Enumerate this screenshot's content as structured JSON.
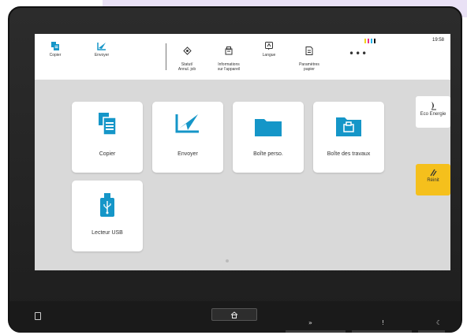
{
  "topbar": {
    "items": [
      {
        "label": "Copier",
        "icon": "copy-icon"
      },
      {
        "label": "Envoyer",
        "icon": "send-icon"
      },
      {
        "label": "Statut/\nAnnul. job",
        "icon": "status-icon"
      },
      {
        "label": "Informations\nsur l'appareil",
        "icon": "device-info-icon"
      },
      {
        "label": "Langue",
        "icon": "language-icon"
      },
      {
        "label": "Paramètres\npapier",
        "icon": "paper-settings-icon"
      }
    ],
    "more": "•••",
    "clock": "19:58",
    "toner_colors": [
      "#f2d21b",
      "#e8318a",
      "#27b3e6",
      "#111111"
    ]
  },
  "tiles": [
    {
      "label": "Copier",
      "icon": "copy-icon"
    },
    {
      "label": "Envoyer",
      "icon": "send-icon"
    },
    {
      "label": "Boîte perso.",
      "icon": "folder-icon"
    },
    {
      "label": "Boîte des travaux",
      "icon": "job-box-icon"
    },
    {
      "label": "Lecteur USB",
      "icon": "usb-icon"
    }
  ],
  "side": {
    "eco_label": "Eco Energie",
    "reinit_label": "Réinit"
  },
  "hardware": {
    "home_icon": "home-icon",
    "indicators": [
      "»",
      "!",
      "☾"
    ]
  },
  "colors": {
    "accent": "#1596c8",
    "reinit": "#f5c01c"
  }
}
